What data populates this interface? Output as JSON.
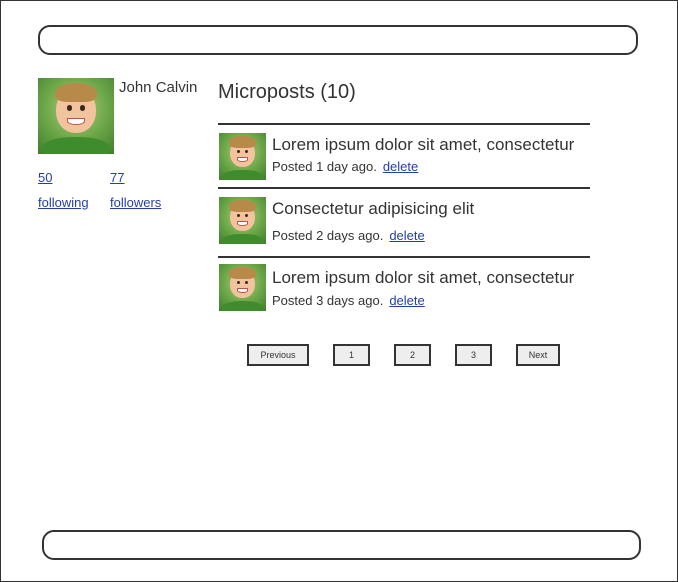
{
  "profile": {
    "name": "John Calvin",
    "following_count": "50",
    "following_label": "following",
    "followers_count": "77",
    "followers_label": "followers"
  },
  "microposts": {
    "title": "Microposts (10)",
    "items": [
      {
        "content": "Lorem ipsum dolor sit amet, consectetur",
        "timestamp": "Posted 1 day ago.",
        "delete_label": "delete"
      },
      {
        "content": "Consectetur adipisicing elit",
        "timestamp": "Posted 2 days ago.",
        "delete_label": "delete"
      },
      {
        "content": "Lorem ipsum dolor sit amet, consectetur",
        "timestamp": "Posted 3 days ago.",
        "delete_label": "delete"
      }
    ]
  },
  "pagination": {
    "previous_label": "Previous",
    "pages": [
      "1",
      "2",
      "3"
    ],
    "next_label": "Next"
  },
  "colors": {
    "link": "#2540a5",
    "border": "#333333",
    "text": "#333333"
  }
}
